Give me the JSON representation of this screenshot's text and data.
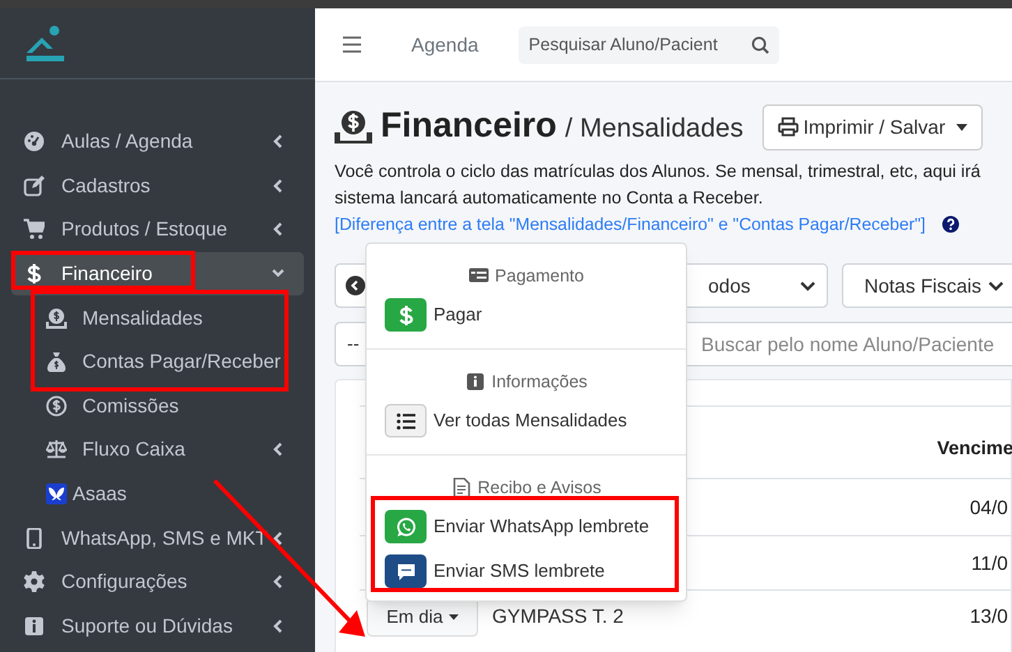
{
  "sidebar": {
    "items": [
      {
        "label": "Aulas / Agenda",
        "kind": "submenu",
        "expanded": false,
        "selected": false
      },
      {
        "label": "Cadastros",
        "kind": "submenu",
        "expanded": false,
        "selected": false
      },
      {
        "label": "Produtos / Estoque",
        "kind": "submenu",
        "expanded": false,
        "selected": false
      },
      {
        "label": "Financeiro",
        "kind": "submenu",
        "expanded": true,
        "selected": true,
        "children": [
          {
            "label": "Mensalidades",
            "kind": "link"
          },
          {
            "label": "Contas Pagar/Receber",
            "kind": "link"
          },
          {
            "label": "Comissões",
            "kind": "link"
          },
          {
            "label": "Fluxo Caixa",
            "kind": "submenu",
            "expanded": false
          },
          {
            "label": "Asaas",
            "kind": "link"
          }
        ]
      },
      {
        "label": "WhatsApp, SMS e MKT",
        "kind": "submenu",
        "expanded": false,
        "selected": false
      },
      {
        "label": "Configurações",
        "kind": "submenu",
        "expanded": false,
        "selected": false
      },
      {
        "label": "Suporte ou Dúvidas",
        "kind": "submenu",
        "expanded": false,
        "selected": false
      }
    ]
  },
  "navbar": {
    "link": "Agenda",
    "search": {
      "placeholder": "Pesquisar Aluno/Pacient"
    }
  },
  "page": {
    "title": "Financeiro",
    "subtitle": "/ Mensalidades",
    "print_button": "Imprimir / Salvar",
    "description": "Você controla o ciclo das matrículas dos Alunos. Se mensal, trimestral, etc, aqui irá sistema lancará automaticamente no Conta a Receber.",
    "help_link": "[Diferença entre a tela \"Mensalidades/Financeiro\" e \"Contas Pagar/Receber\"]"
  },
  "filters": {
    "period_select": "odos",
    "invoice_select": "Notas Fiscais",
    "status_select": "--",
    "search": {
      "placeholder": "Buscar pelo nome Aluno/Paciente"
    }
  },
  "table": {
    "columns": [
      {
        "label": "Vencime"
      }
    ],
    "rows": [
      {
        "column_1": "04/0"
      },
      {
        "column_1": "11/0"
      },
      {
        "status_button": "Em dia",
        "name": "GYMPASS T. 2",
        "column_1": "13/0"
      }
    ]
  },
  "dropdown": {
    "sections": [
      {
        "header": "Pagamento",
        "items": [
          {
            "label": "Pagar"
          }
        ]
      },
      {
        "header": "Informações",
        "items": [
          {
            "label": "Ver todas Mensalidades"
          }
        ]
      },
      {
        "header": "Recibo e Avisos",
        "items": [
          {
            "label": "Enviar WhatsApp lembrete"
          },
          {
            "label": "Enviar SMS lembrete"
          }
        ]
      }
    ]
  }
}
